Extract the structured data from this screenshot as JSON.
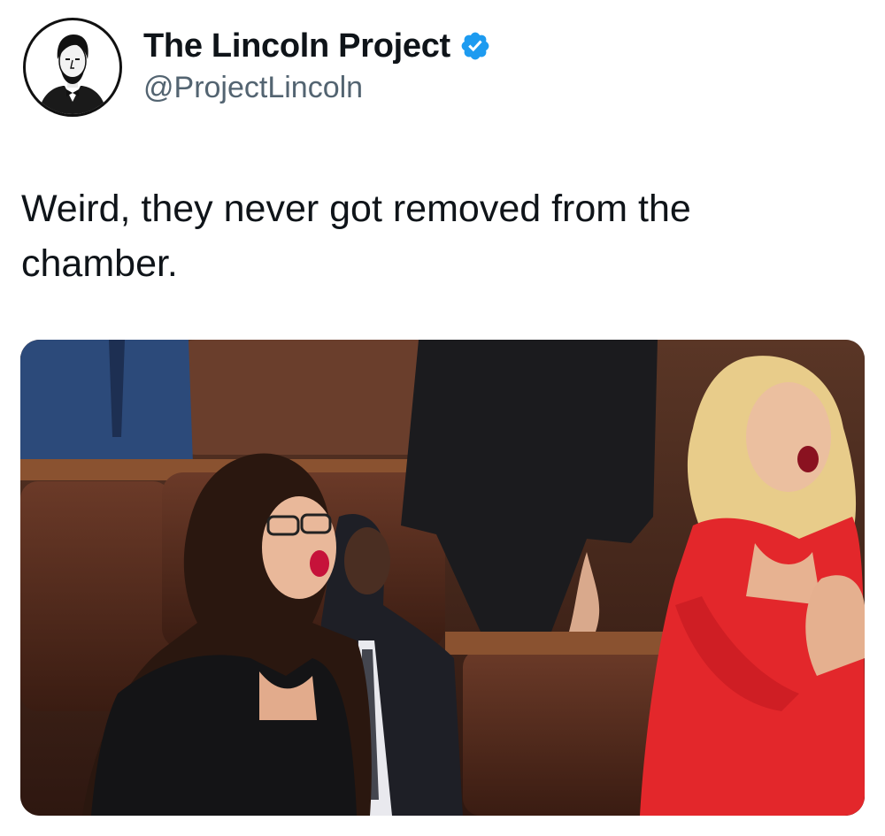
{
  "tweet": {
    "author": {
      "display_name": "The Lincoln Project",
      "handle": "@ProjectLincoln",
      "verified": true,
      "avatar_icon": "abraham-lincoln-portrait-icon"
    },
    "text": "Weird, they never got removed from the chamber.",
    "media": {
      "type": "photo",
      "icon": "photo-image"
    }
  },
  "colors": {
    "verified_badge": "#1d9bf0",
    "handle": "#536471",
    "text": "#0f1419"
  }
}
